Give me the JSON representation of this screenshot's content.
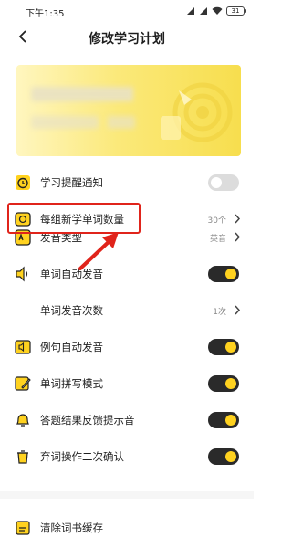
{
  "status_bar": {
    "time": "下午1:35",
    "battery": "31"
  },
  "nav": {
    "title": "修改学习计划"
  },
  "colors": {
    "accent": "#ffd21f",
    "toggle_track_on": "#2a2a2a",
    "highlight": "#e0241b",
    "muted_text": "#8a8a8a"
  },
  "settings": [
    {
      "label": "学习提醒通知",
      "control": "toggle",
      "on": false,
      "icon": "alarm-clock-icon"
    },
    {
      "label": "每组新学单词数量",
      "control": "value",
      "value": "30个",
      "icon": "camera-word-icon"
    },
    {
      "label": "发音类型",
      "control": "value",
      "value": "英音",
      "icon": "pronunciation-icon"
    },
    {
      "label": "单词自动发音",
      "control": "toggle",
      "on": true,
      "icon": "speaker-icon"
    },
    {
      "label": "单词发音次数",
      "control": "value",
      "value": "1次",
      "icon": ""
    },
    {
      "label": "例句自动发音",
      "control": "toggle",
      "on": true,
      "icon": "speaker-book-icon"
    },
    {
      "label": "单词拼写模式",
      "control": "toggle",
      "on": true,
      "icon": "pencil-icon"
    },
    {
      "label": "答题结果反馈提示音",
      "control": "toggle",
      "on": true,
      "icon": "bell-icon"
    },
    {
      "label": "弃词操作二次确认",
      "control": "toggle",
      "on": true,
      "icon": "trash-icon"
    },
    {
      "label": "清除词书缓存",
      "control": "none",
      "icon": "broom-icon"
    }
  ]
}
